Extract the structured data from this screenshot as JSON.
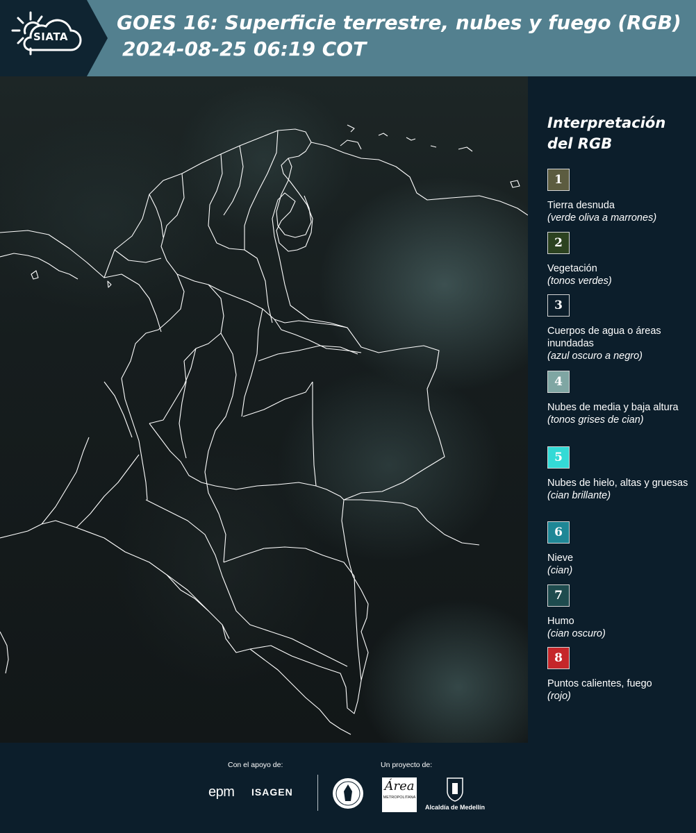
{
  "header": {
    "logo_text": "SIATA",
    "title_line1": "GOES 16: Superficie terrestre, nubes y fuego (RGB)",
    "title_line2": "2024-08-25 06:19 COT"
  },
  "legend": {
    "title_line1": "Interpretación",
    "title_line2": "del RGB",
    "items": [
      {
        "num": "1",
        "color": "#5c5c40",
        "label": "Tierra desnuda",
        "sub": "(verde oliva a marrones)"
      },
      {
        "num": "2",
        "color": "#2c4220",
        "label": "Vegetación",
        "sub": "(tonos verdes)"
      },
      {
        "num": "3",
        "color": "#0c1e2b",
        "label": "Cuerpos de agua o áreas inundadas",
        "sub": "(azul oscuro a negro)"
      },
      {
        "num": "4",
        "color": "#7fa6a3",
        "label": "Nubes de media y baja altura",
        "sub": "(tonos grises de cian)"
      },
      {
        "num": "5",
        "color": "#33dad6",
        "label": "Nubes de hielo, altas y gruesas",
        "sub": "(cian brillante)"
      },
      {
        "num": "6",
        "color": "#1e8796",
        "label": "Nieve",
        "sub": "(cian)"
      },
      {
        "num": "7",
        "color": "#1e4b4e",
        "label": "Humo",
        "sub": "(cian oscuro)"
      },
      {
        "num": "8",
        "color": "#c5262a",
        "label": "Puntos calientes, fuego",
        "sub": "(rojo)"
      }
    ]
  },
  "footer": {
    "support_label": "Con el apoyo de:",
    "project_label": "Un proyecto de:",
    "epm": "epm",
    "isagen": "ISAGEN",
    "area_logo_big": "Área",
    "area_logo_small": "METROPOLITANA",
    "alcaldia": "Alcaldía de Medellín"
  },
  "colors": {
    "header_bg": "#53808f",
    "panel_bg": "#0c1e2b",
    "boundary_lines": "#ffffff"
  }
}
